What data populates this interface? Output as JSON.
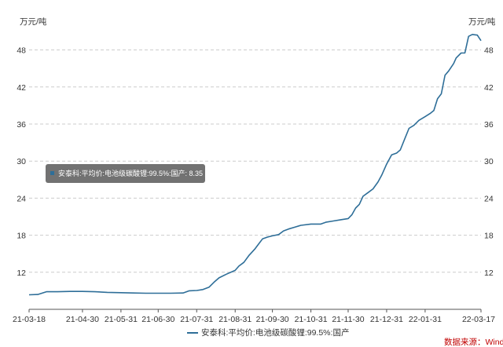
{
  "chart_data": {
    "type": "line",
    "unit_left": "万元/吨",
    "unit_right": "万元/吨",
    "ylim": [
      6,
      51
    ],
    "y_ticks": [
      12,
      18,
      24,
      30,
      36,
      42,
      48
    ],
    "x_ticks": [
      "21-03-18",
      "21-04-30",
      "21-05-31",
      "21-06-30",
      "21-07-31",
      "21-08-31",
      "21-09-30",
      "21-10-31",
      "21-11-30",
      "21-12-31",
      "22-01-31",
      "22-03-17"
    ],
    "grid": true,
    "legend_position": "bottom-center",
    "series": [
      {
        "name": "安泰科:平均价:电池级碳酸锂:99.5%:国产",
        "color": "#2e6e98",
        "points": [
          [
            "2021-03-18",
            8.35
          ],
          [
            "2021-03-25",
            8.4
          ],
          [
            "2021-04-01",
            8.85
          ],
          [
            "2021-04-10",
            8.85
          ],
          [
            "2021-04-20",
            8.9
          ],
          [
            "2021-04-30",
            8.9
          ],
          [
            "2021-05-10",
            8.85
          ],
          [
            "2021-05-20",
            8.75
          ],
          [
            "2021-05-31",
            8.7
          ],
          [
            "2021-06-10",
            8.65
          ],
          [
            "2021-06-20",
            8.6
          ],
          [
            "2021-06-30",
            8.6
          ],
          [
            "2021-07-10",
            8.6
          ],
          [
            "2021-07-20",
            8.65
          ],
          [
            "2021-07-25",
            9.0
          ],
          [
            "2021-07-31",
            9.05
          ],
          [
            "2021-08-05",
            9.2
          ],
          [
            "2021-08-10",
            9.6
          ],
          [
            "2021-08-14",
            10.4
          ],
          [
            "2021-08-18",
            11.1
          ],
          [
            "2021-08-24",
            11.7
          ],
          [
            "2021-08-31",
            12.3
          ],
          [
            "2021-09-03",
            13.0
          ],
          [
            "2021-09-07",
            13.6
          ],
          [
            "2021-09-11",
            14.7
          ],
          [
            "2021-09-16",
            15.8
          ],
          [
            "2021-09-19",
            16.6
          ],
          [
            "2021-09-22",
            17.4
          ],
          [
            "2021-09-26",
            17.7
          ],
          [
            "2021-09-30",
            17.9
          ],
          [
            "2021-10-05",
            18.1
          ],
          [
            "2021-10-09",
            18.7
          ],
          [
            "2021-10-13",
            19.0
          ],
          [
            "2021-10-18",
            19.3
          ],
          [
            "2021-10-23",
            19.6
          ],
          [
            "2021-10-31",
            19.8
          ],
          [
            "2021-11-08",
            19.8
          ],
          [
            "2021-11-12",
            20.1
          ],
          [
            "2021-11-18",
            20.3
          ],
          [
            "2021-11-24",
            20.5
          ],
          [
            "2021-11-30",
            20.7
          ],
          [
            "2021-12-03",
            21.3
          ],
          [
            "2021-12-06",
            22.4
          ],
          [
            "2021-12-09",
            23.0
          ],
          [
            "2021-12-12",
            24.3
          ],
          [
            "2021-12-16",
            24.9
          ],
          [
            "2021-12-20",
            25.5
          ],
          [
            "2021-12-24",
            26.6
          ],
          [
            "2021-12-27",
            27.7
          ],
          [
            "2021-12-31",
            29.5
          ],
          [
            "2022-01-04",
            31.0
          ],
          [
            "2022-01-08",
            31.3
          ],
          [
            "2022-01-11",
            31.8
          ],
          [
            "2022-01-15",
            33.8
          ],
          [
            "2022-01-18",
            35.3
          ],
          [
            "2022-01-22",
            35.8
          ],
          [
            "2022-01-26",
            36.6
          ],
          [
            "2022-01-31",
            37.2
          ],
          [
            "2022-02-04",
            37.7
          ],
          [
            "2022-02-07",
            38.2
          ],
          [
            "2022-02-10",
            40.1
          ],
          [
            "2022-02-13",
            40.9
          ],
          [
            "2022-02-16",
            43.9
          ],
          [
            "2022-02-19",
            44.6
          ],
          [
            "2022-02-23",
            45.8
          ],
          [
            "2022-02-25",
            46.7
          ],
          [
            "2022-03-01",
            47.5
          ],
          [
            "2022-03-04",
            47.5
          ],
          [
            "2022-03-07",
            50.2
          ],
          [
            "2022-03-10",
            50.5
          ],
          [
            "2022-03-14",
            50.4
          ],
          [
            "2022-03-17",
            49.5
          ]
        ]
      }
    ],
    "tooltip": {
      "text": "安泰科:平均价:电池级碳酸锂:99.5%:国产: 8.35 万元/吨"
    },
    "source": "数据来源：Wind"
  }
}
